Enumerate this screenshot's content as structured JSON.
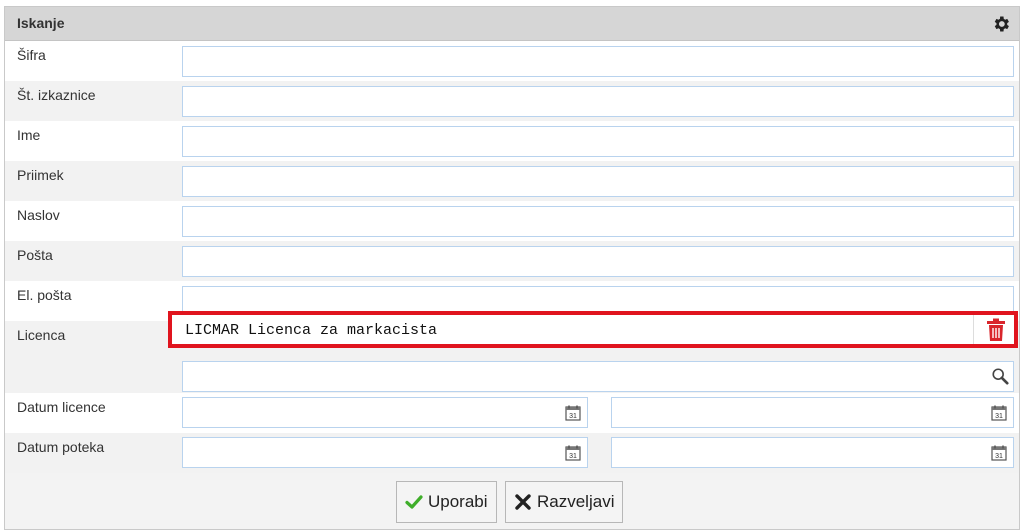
{
  "panel": {
    "title": "Iskanje",
    "settings_icon": "gear-icon"
  },
  "fields": {
    "sifra": {
      "label": "Šifra",
      "value": ""
    },
    "st_izkaznice": {
      "label": "Št. izkaznice",
      "value": ""
    },
    "ime": {
      "label": "Ime",
      "value": ""
    },
    "priimek": {
      "label": "Priimek",
      "value": ""
    },
    "naslov": {
      "label": "Naslov",
      "value": ""
    },
    "posta": {
      "label": "Pošta",
      "value": ""
    },
    "el_posta": {
      "label": "El. pošta",
      "value": ""
    },
    "licenca": {
      "label": "Licenca",
      "selected": "LICMAR Licenca za markacista",
      "search_value": ""
    },
    "datum_licence": {
      "label": "Datum licence",
      "from": "",
      "to": ""
    },
    "datum_poteka": {
      "label": "Datum poteka",
      "from": "",
      "to": ""
    }
  },
  "buttons": {
    "apply": "Uporabi",
    "cancel": "Razveljavi"
  },
  "colors": {
    "highlight": "#e0141e",
    "trash": "#d9262c",
    "apply_check": "#3fae2a"
  }
}
